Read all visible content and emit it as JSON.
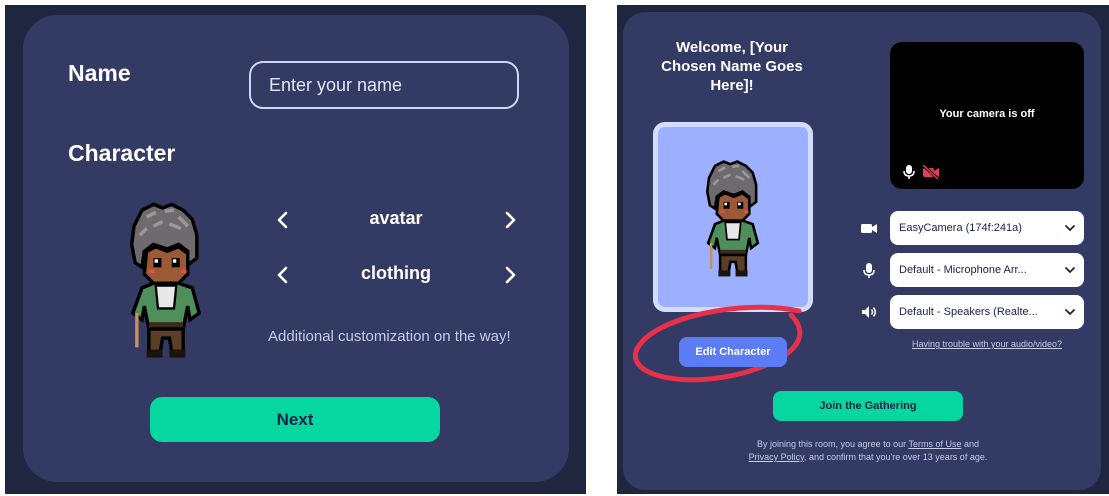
{
  "setup": {
    "name_label": "Name",
    "name_placeholder": "Enter your name",
    "character_label": "Character",
    "avatar_label": "avatar",
    "clothing_label": "clothing",
    "customization_note": "Additional customization on the way!",
    "next_label": "Next"
  },
  "lobby": {
    "welcome": "Welcome, [Your Chosen Name Goes Here]!",
    "camera_status": "Your camera is off",
    "edit_character_label": "Edit Character",
    "devices": {
      "camera": "EasyCamera (174f:241a)",
      "microphone": "Default - Microphone Arr...",
      "speaker": "Default - Speakers (Realte..."
    },
    "trouble_link": "Having trouble with your audio/video?",
    "join_label": "Join the Gathering",
    "legal": {
      "part1": "By joining this room, you agree to our",
      "terms": "Terms of Use",
      "part2": "and",
      "privacy": "Privacy Policy",
      "part3": ", and confirm that you're over 13 years of age."
    }
  },
  "icons": {
    "prev": "chevron-left-icon",
    "next": "chevron-right-icon",
    "dropdown": "chevron-down-icon",
    "camera": "video-camera-icon",
    "camera_off": "video-camera-off-icon",
    "microphone": "microphone-icon",
    "speaker": "speaker-icon"
  },
  "colors": {
    "card_background": "#333a64",
    "frame_background": "#202540",
    "accent_green": "#06d6a0",
    "edit_button_blue": "#5b7cf4",
    "avatar_preview_bg": "#9cb0ff",
    "camera_off_red": "#e0405e",
    "annotation_red": "#e8304a"
  }
}
